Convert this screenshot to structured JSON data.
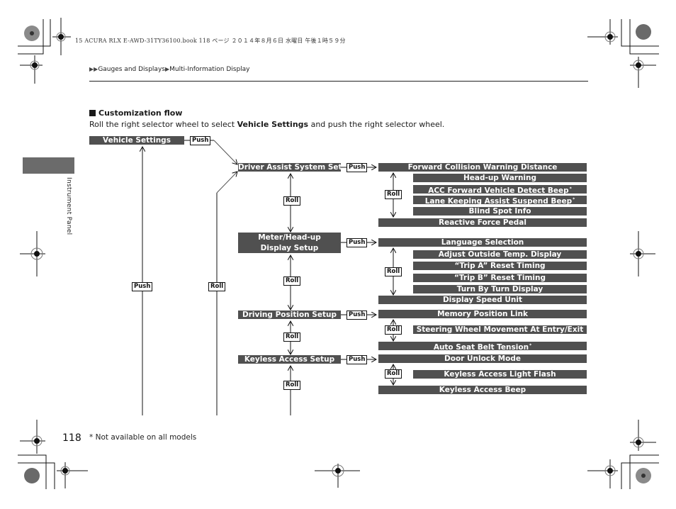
{
  "print_header": "15 ACURA RLX E-AWD-31TY36100.book  118 ページ  ２０１４年８月６日  水曜日  午後１時５９分",
  "breadcrumb": {
    "items": [
      "Gauges and Displays",
      "Multi-Information Display"
    ]
  },
  "side_tab": {
    "label": "Instrument Panel"
  },
  "section": {
    "title": "Customization flow",
    "intro_before": "Roll the right selector wheel to select ",
    "intro_bold": "Vehicle Settings",
    "intro_after": " and push the right selector wheel."
  },
  "flow": {
    "root": "Vehicle Settings",
    "push_label": "Push",
    "roll_label": "Roll",
    "groups": [
      {
        "title": "Driver Assist System Setup",
        "items": [
          {
            "label": "Forward Collision Warning Distance",
            "note": ""
          },
          {
            "label": "Head-up Warning",
            "note": ""
          },
          {
            "label": "ACC Forward Vehicle Detect Beep",
            "note": "*"
          },
          {
            "label": "Lane Keeping Assist Suspend Beep",
            "note": "*"
          },
          {
            "label": "Blind Spot Info",
            "note": ""
          },
          {
            "label": "Reactive Force Pedal",
            "note": ""
          }
        ]
      },
      {
        "title": "Meter/Head-up Display Setup",
        "items": [
          {
            "label": "Language Selection",
            "note": ""
          },
          {
            "label": "Adjust Outside Temp. Display",
            "note": ""
          },
          {
            "label": "“Trip A” Reset Timing",
            "note": ""
          },
          {
            "label": "“Trip B” Reset Timing",
            "note": ""
          },
          {
            "label": "Turn By Turn Display",
            "note": ""
          },
          {
            "label": "Display Speed Unit",
            "note": ""
          }
        ]
      },
      {
        "title": "Driving Position Setup",
        "items": [
          {
            "label": "Memory Position Link",
            "note": ""
          },
          {
            "label": "Steering Wheel Movement At Entry/Exit",
            "note": ""
          },
          {
            "label": "Auto Seat Belt Tension",
            "note": "*"
          }
        ]
      },
      {
        "title": "Keyless Access Setup",
        "items": [
          {
            "label": "Door Unlock Mode",
            "note": ""
          },
          {
            "label": "Keyless Access Light Flash",
            "note": ""
          },
          {
            "label": "Keyless Access Beep",
            "note": ""
          }
        ]
      }
    ]
  },
  "footer": {
    "page_number": "118",
    "footnote": "* Not available on all models"
  },
  "colors": {
    "bar": "#505050",
    "side_tab": "#6b6b6b",
    "text": "#1a1a1a"
  }
}
